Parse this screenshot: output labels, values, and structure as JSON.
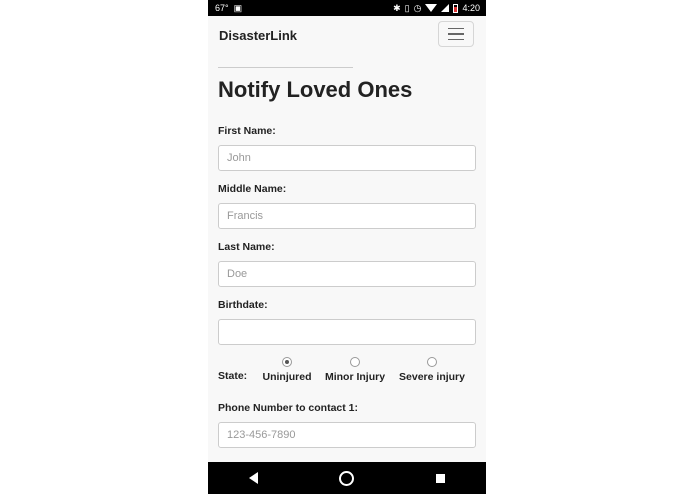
{
  "statusbar": {
    "temperature": "67°",
    "time": "4:20"
  },
  "navbar": {
    "brand": "DisasterLink"
  },
  "page": {
    "title": "Notify Loved Ones"
  },
  "form": {
    "first_name_label": "First Name:",
    "first_name_placeholder": "John",
    "middle_name_label": "Middle Name:",
    "middle_name_placeholder": "Francis",
    "last_name_label": "Last Name:",
    "last_name_placeholder": "Doe",
    "birthdate_label": "Birthdate:",
    "state_label": "State:",
    "state_options": [
      "Uninjured",
      "Minor Injury",
      "Severe injury"
    ],
    "state_selected": "Uninjured",
    "phone_label": "Phone Number to contact 1:",
    "phone_placeholder": "123-456-7890"
  }
}
